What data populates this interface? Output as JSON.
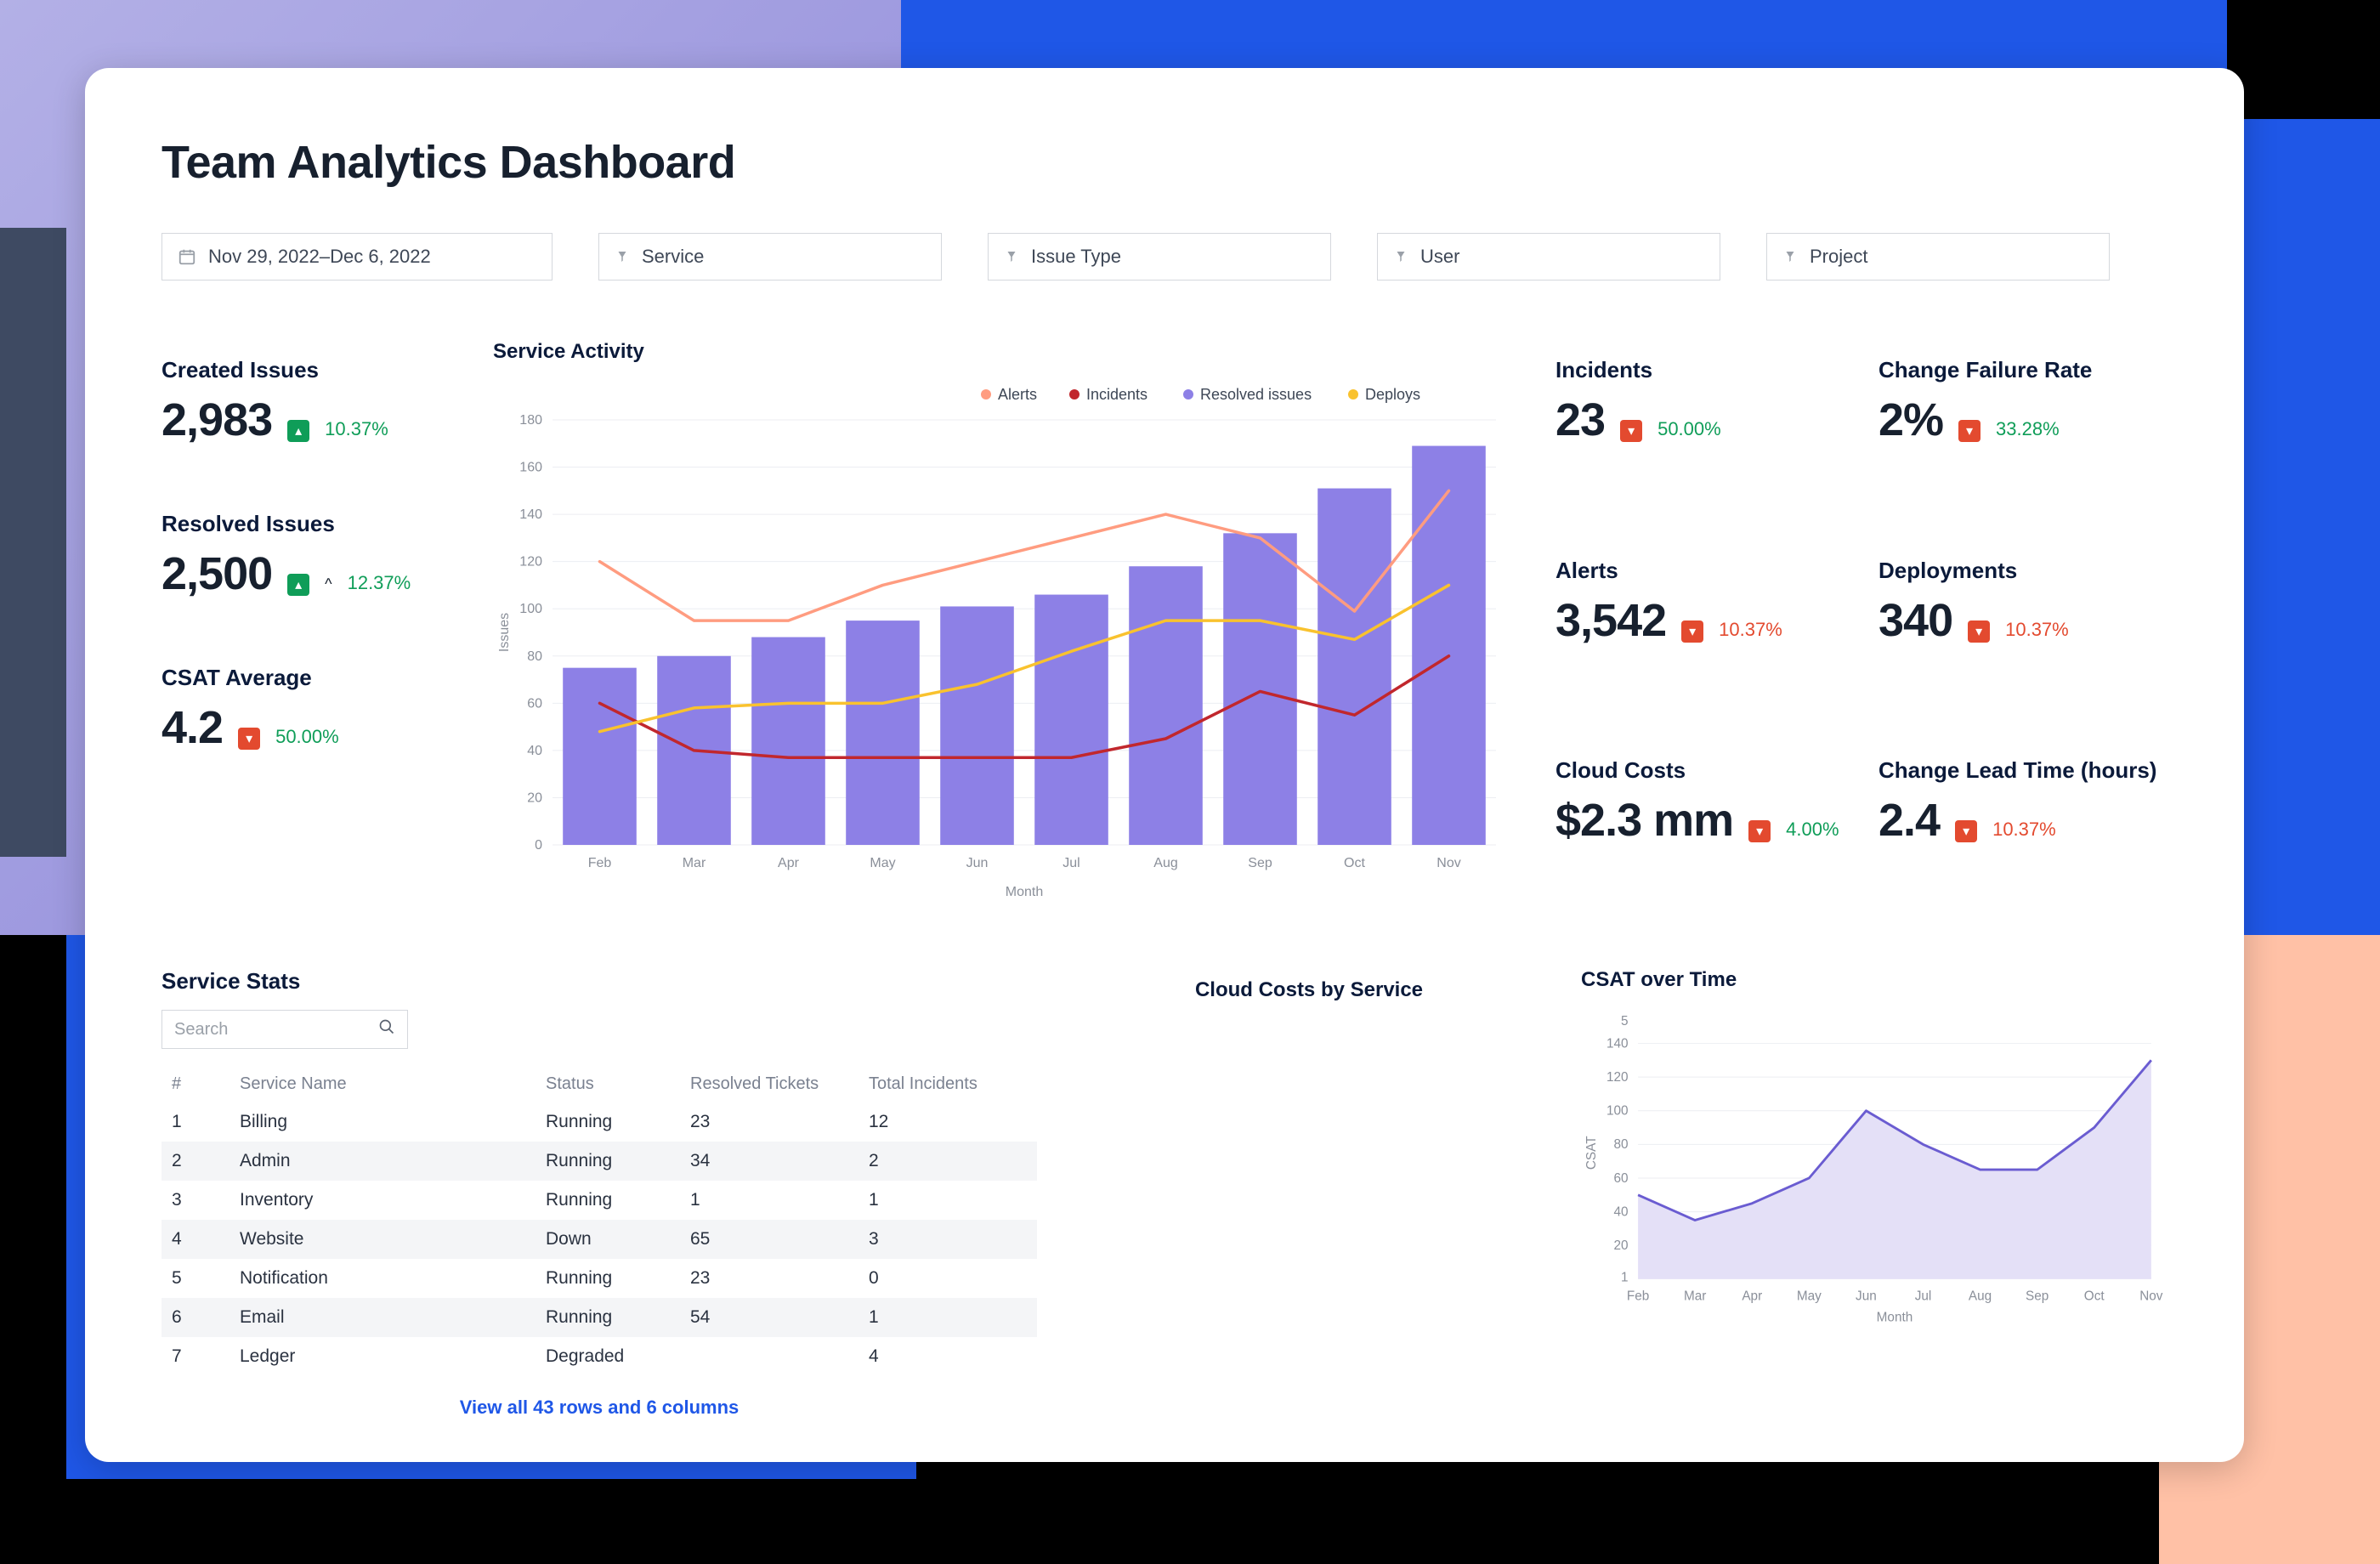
{
  "title": "Team Analytics Dashboard",
  "filters": {
    "date_range": "Nov 29, 2022–Dec 6, 2022",
    "service": "Service",
    "issue_type": "Issue Type",
    "user": "User",
    "project": "Project"
  },
  "left_stats": {
    "created": {
      "label": "Created Issues",
      "value": "2,983",
      "badge_dir": "up",
      "badge_color": "green",
      "delta": "10.37%",
      "delta_color": "green"
    },
    "resolved": {
      "label": "Resolved Issues",
      "value": "2,500",
      "badge_dir": "up",
      "badge_color": "green",
      "caret": "^",
      "delta": "12.37%",
      "delta_color": "green"
    },
    "csat": {
      "label": "CSAT Average",
      "value": "4.2",
      "badge_dir": "down",
      "badge_color": "red",
      "delta": "50.00%",
      "delta_color": "green"
    }
  },
  "right_stats": {
    "incidents": {
      "label": "Incidents",
      "value": "23",
      "badge_dir": "down",
      "badge_color": "red",
      "delta": "50.00%",
      "delta_color": "green"
    },
    "cfr": {
      "label": "Change Failure Rate",
      "value": "2%",
      "badge_dir": "down",
      "badge_color": "red",
      "delta": "33.28%",
      "delta_color": "green"
    },
    "alerts": {
      "label": "Alerts",
      "value": "3,542",
      "badge_dir": "down",
      "badge_color": "red",
      "delta": "10.37%",
      "delta_color": "red"
    },
    "deployments": {
      "label": "Deployments",
      "value": "340",
      "badge_dir": "down",
      "badge_color": "red",
      "delta": "10.37%",
      "delta_color": "red"
    },
    "cloud": {
      "label": "Cloud Costs",
      "value": "$2.3 mm",
      "badge_dir": "down",
      "badge_color": "red",
      "delta": "4.00%",
      "delta_color": "green"
    },
    "clt": {
      "label": "Change Lead Time (hours)",
      "value": "2.4",
      "badge_dir": "down",
      "badge_color": "red",
      "delta": "10.37%",
      "delta_color": "red"
    }
  },
  "service_activity": {
    "title": "Service Activity",
    "xlabel": "Month",
    "ylabel": "Issues",
    "legend": {
      "alerts": "Alerts",
      "incidents": "Incidents",
      "resolved": "Resolved issues",
      "deploys": "Deploys"
    }
  },
  "chart_data": [
    {
      "id": "service_activity",
      "type": "bar+line",
      "title": "Service Activity",
      "xlabel": "Month",
      "ylabel": "Issues",
      "categories": [
        "Feb",
        "Mar",
        "Apr",
        "May",
        "Jun",
        "Jul",
        "Aug",
        "Sep",
        "Oct",
        "Nov"
      ],
      "ylim": [
        0,
        180
      ],
      "yticks": [
        0,
        20,
        40,
        60,
        80,
        100,
        120,
        140,
        160,
        180
      ],
      "series": [
        {
          "name": "Resolved issues",
          "type": "bar",
          "color": "#8d80e6",
          "values": [
            75,
            80,
            88,
            95,
            101,
            106,
            118,
            132,
            151,
            169
          ]
        },
        {
          "name": "Alerts",
          "type": "line",
          "color": "#ff9c80",
          "values": [
            120,
            95,
            95,
            110,
            120,
            130,
            140,
            130,
            99,
            150
          ]
        },
        {
          "name": "Incidents",
          "type": "line",
          "color": "#c1272d",
          "values": [
            60,
            40,
            37,
            37,
            37,
            37,
            45,
            65,
            55,
            80
          ]
        },
        {
          "name": "Deploys",
          "type": "line",
          "color": "#f9c22e",
          "values": [
            48,
            58,
            60,
            60,
            68,
            82,
            95,
            95,
            87,
            110
          ]
        }
      ]
    },
    {
      "id": "csat_over_time",
      "type": "area",
      "title": "CSAT over Time",
      "xlabel": "Month",
      "ylabel": "CSAT",
      "categories": [
        "Feb",
        "Mar",
        "Apr",
        "May",
        "Jun",
        "Jul",
        "Aug",
        "Sep",
        "Oct",
        "Nov"
      ],
      "yticks": [
        1,
        20,
        40,
        60,
        80,
        100,
        120,
        140,
        "5"
      ],
      "series": [
        {
          "name": "CSAT",
          "color": "#8d80e6",
          "values": [
            50,
            35,
            45,
            60,
            100,
            80,
            65,
            65,
            90,
            130
          ]
        }
      ]
    }
  ],
  "service_stats": {
    "title": "Service Stats",
    "search_placeholder": "Search",
    "columns": {
      "idx": "#",
      "name": "Service Name",
      "status": "Status",
      "resolved": "Resolved Tickets",
      "incidents": "Total Incidents"
    },
    "rows": [
      {
        "idx": "1",
        "name": "Billing",
        "status": "Running",
        "status_class": "",
        "resolved": "23",
        "incidents": "12"
      },
      {
        "idx": "2",
        "name": "Admin",
        "status": "Running",
        "status_class": "",
        "resolved": "34",
        "incidents": "2"
      },
      {
        "idx": "3",
        "name": "Inventory",
        "status": "Running",
        "status_class": "",
        "resolved": "1",
        "incidents": "1"
      },
      {
        "idx": "4",
        "name": "Website",
        "status": "Down",
        "status_class": "status-down",
        "resolved": "65",
        "incidents": "3"
      },
      {
        "idx": "5",
        "name": "Notification",
        "status": "Running",
        "status_class": "",
        "resolved": "23",
        "incidents": "0"
      },
      {
        "idx": "6",
        "name": "Email",
        "status": "Running",
        "status_class": "",
        "resolved": "54",
        "incidents": "1"
      },
      {
        "idx": "7",
        "name": "Ledger",
        "status": "Degraded",
        "status_class": "status-degraded",
        "resolved": "",
        "incidents": "4"
      }
    ],
    "view_all": "View all 43 rows and 6 columns"
  },
  "cloud_costs_title": "Cloud Costs by Service",
  "csat_chart_title": "CSAT over Time"
}
